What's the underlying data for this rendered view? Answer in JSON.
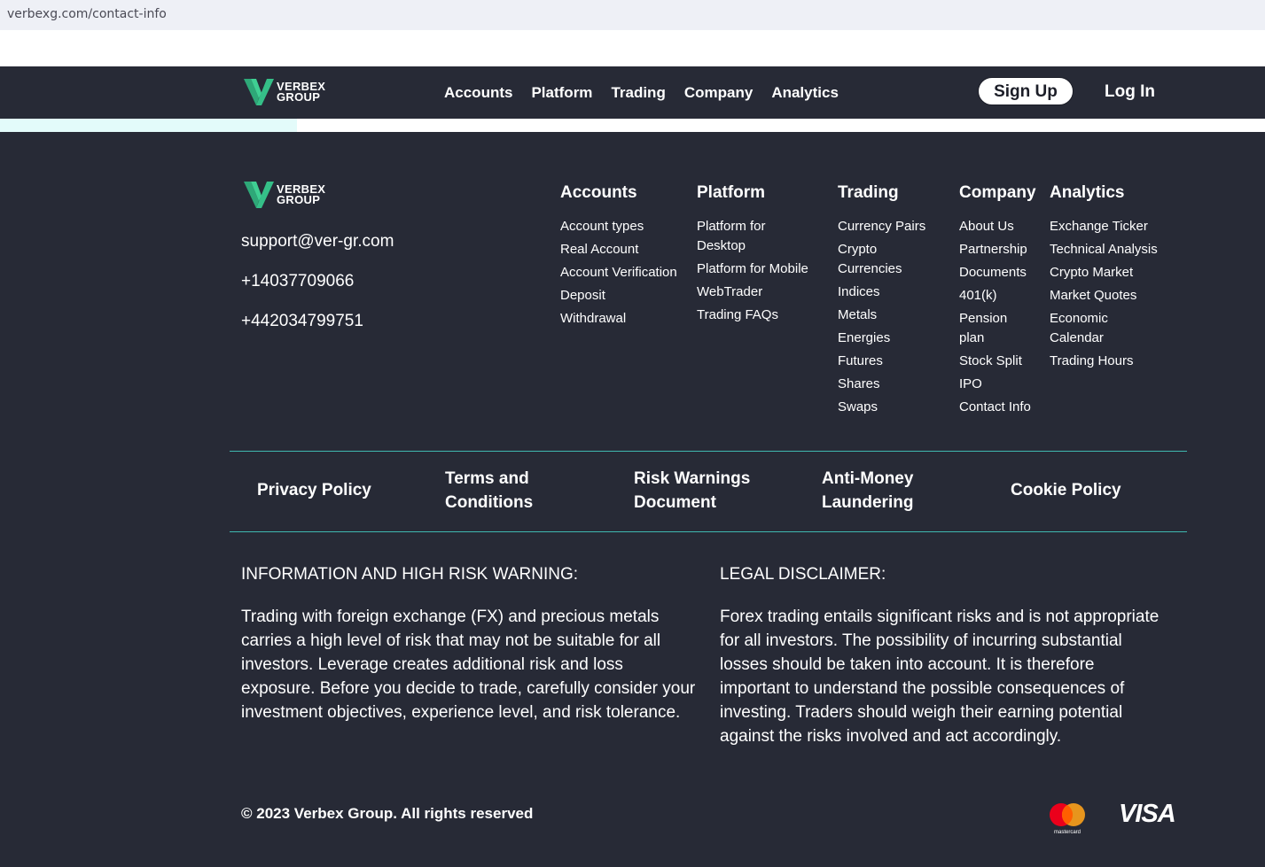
{
  "browser": {
    "url": "verbexg.com/contact-info"
  },
  "brand": {
    "line1": "VERBEX",
    "line2": "GROUP",
    "accent": "#3fcf93"
  },
  "nav": {
    "links": [
      "Accounts",
      "Platform",
      "Trading",
      "Company",
      "Analytics"
    ],
    "signup": "Sign Up",
    "login": "Log In"
  },
  "progress": {
    "fraction": 0.235
  },
  "contact": {
    "email": "support@ver-gr.com",
    "phone1": "+14037709066",
    "phone2": "+442034799751"
  },
  "footer_columns": [
    {
      "title": "Accounts",
      "items": [
        "Account types",
        "Real Account",
        "Account Verification",
        "Deposit",
        "Withdrawal"
      ]
    },
    {
      "title": "Platform",
      "items": [
        "Platform for Desktop",
        "Platform for Mobile",
        "WebTrader",
        "Trading FAQs"
      ]
    },
    {
      "title": "Trading",
      "items": [
        "Currency Pairs",
        "Crypto Currencies",
        "Indices",
        "Metals",
        "Energies",
        "Futures",
        "Shares",
        "Swaps"
      ]
    },
    {
      "title": "Company",
      "items": [
        "About Us",
        "Partnership",
        "Documents",
        "401(k)",
        "Pension plan",
        "Stock Split",
        "IPO",
        "Contact Info"
      ]
    },
    {
      "title": "Analytics",
      "items": [
        "Exchange Ticker",
        "Technical Analysis",
        "Crypto Market",
        "Market Quotes",
        "Economic Calendar",
        "Trading Hours"
      ]
    }
  ],
  "legal_links": [
    "Privacy Policy",
    "Terms and Conditions",
    "Risk Warnings Document",
    "Anti-Money Laundering",
    "Cookie Policy"
  ],
  "warning": {
    "heading": "INFORMATION AND HIGH RISK WARNING:",
    "body": "Trading with foreign exchange (FX) and precious metals carries a high level of risk that may not be suitable for all investors. Leverage creates additional risk and loss exposure. Before you decide to trade, carefully consider your investment objectives, experience level, and risk tolerance."
  },
  "disclaimer": {
    "heading": "LEGAL DISCLAIMER:",
    "body": "Forex trading entails significant risks and is not appropriate for all investors. The possibility of incurring substantial losses should be taken into account. It is therefore important to understand the possible consequences of investing. Traders should weigh their earning potential against the risks involved and act accordingly."
  },
  "copyright": "© 2023 Verbex Group. All rights reserved",
  "payments": {
    "mastercard_label": "mastercard",
    "visa": "VISA"
  }
}
